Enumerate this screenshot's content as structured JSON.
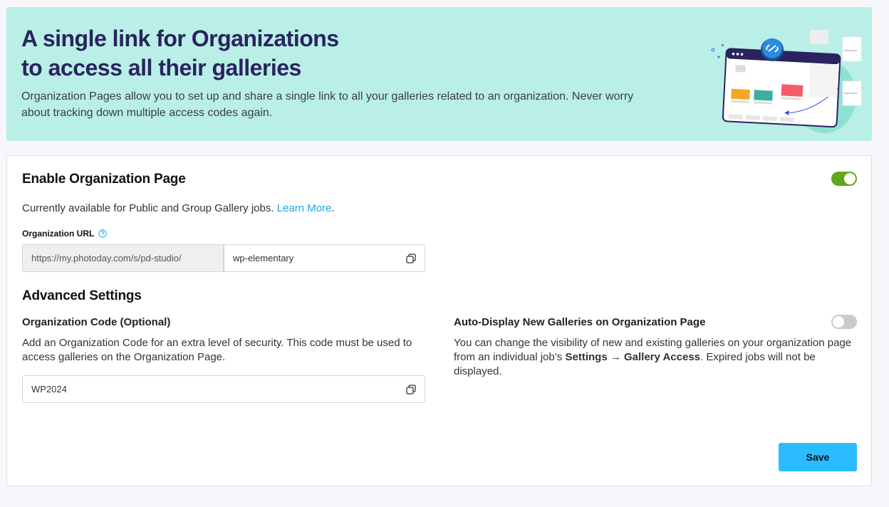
{
  "banner": {
    "title_line1": "A single link for Organizations",
    "title_line2": "to access all their galleries",
    "description": "Organization Pages allow you to set up and share a single link to all your galleries related to an organization. Never worry about tracking down multiple access codes again."
  },
  "enable": {
    "title": "Enable Organization Page",
    "toggle_on": true,
    "availability_text": "Currently available for Public and Group Gallery jobs.",
    "learn_more": "Learn More",
    "period": "."
  },
  "org_url": {
    "label": "Organization URL",
    "prefix": "https://my.photoday.com/s/pd-studio/",
    "slug": "wp-elementary"
  },
  "advanced": {
    "title": "Advanced Settings",
    "code": {
      "label": "Organization Code (Optional)",
      "description": "Add an Organization Code for an extra level of security. This code must be used to access galleries on the Organization Page.",
      "value": "WP2024"
    },
    "auto_display": {
      "label": "Auto-Display New Galleries on Organization Page",
      "toggle_on": false,
      "desc_part1": "You can change the visibility of new and existing galleries on your organization page from an individual job’s ",
      "desc_bold": "Settings → Gallery Access",
      "desc_part2": ". Expired jobs will not be displayed."
    }
  },
  "save_label": "Save",
  "colors": {
    "banner_bg": "#b9efe6",
    "title_color": "#2a2360",
    "toggle_on": "#5fa71e",
    "link": "#1aa7e8",
    "save_button": "#2bbcff"
  }
}
